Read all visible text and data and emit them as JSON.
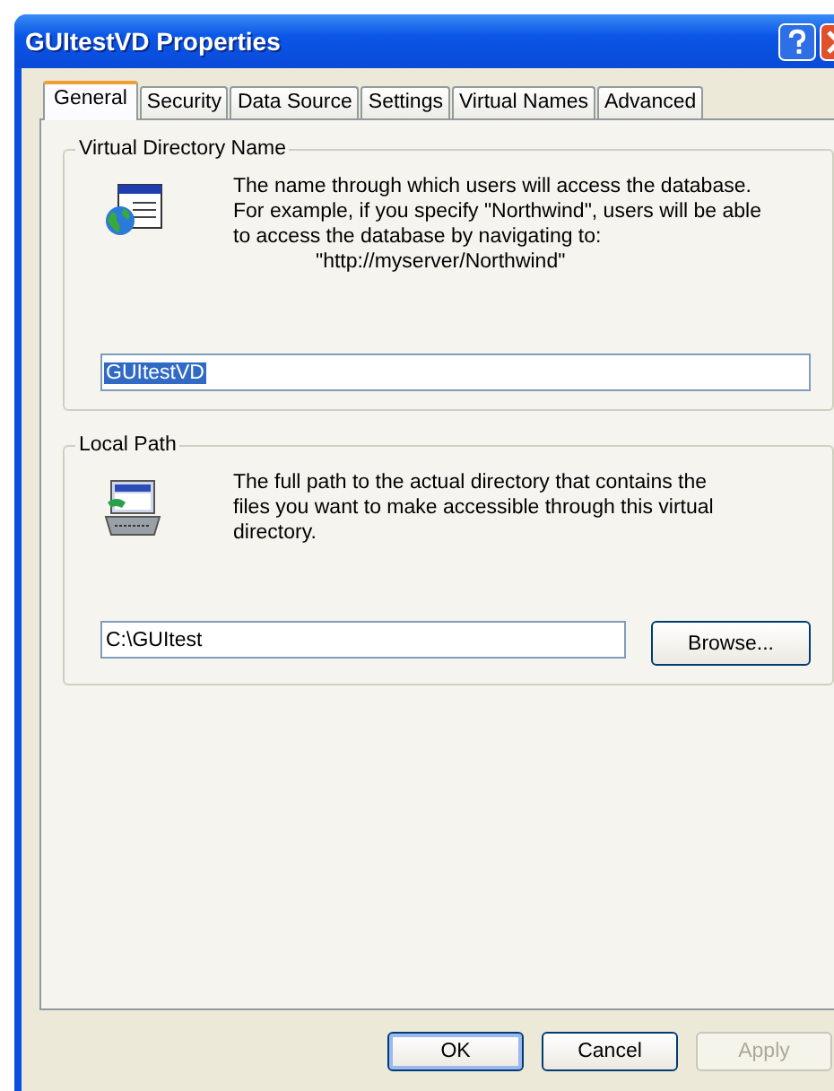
{
  "window": {
    "title": "GUItestVD Properties"
  },
  "tabs": [
    {
      "label": "General",
      "selected": true
    },
    {
      "label": "Security",
      "selected": false
    },
    {
      "label": "Data Source",
      "selected": false
    },
    {
      "label": "Settings",
      "selected": false
    },
    {
      "label": "Virtual Names",
      "selected": false
    },
    {
      "label": "Advanced",
      "selected": false
    }
  ],
  "groups": [
    {
      "legend": "Virtual Directory Name",
      "kind": "globe",
      "description": [
        "The name through which users will access the database.",
        "For example, if you specify \"Northwind\", users will be able",
        "to access the database by navigating to:",
        "\"http://myserver/Northwind\""
      ],
      "field": {
        "value": "GUItestVD",
        "selected": true
      }
    },
    {
      "legend": "Local Path",
      "kind": "computer",
      "description": [
        "The full path to the actual directory that contains the",
        "files you want to make accessible through this virtual",
        "directory."
      ],
      "field": {
        "value": "C:\\GUItest",
        "selected": false
      },
      "button": "Browse..."
    }
  ],
  "buttons": [
    {
      "label": "OK",
      "disabled": false,
      "default": true
    },
    {
      "label": "Cancel",
      "disabled": false,
      "default": false
    },
    {
      "label": "Apply",
      "disabled": true,
      "default": false
    }
  ]
}
